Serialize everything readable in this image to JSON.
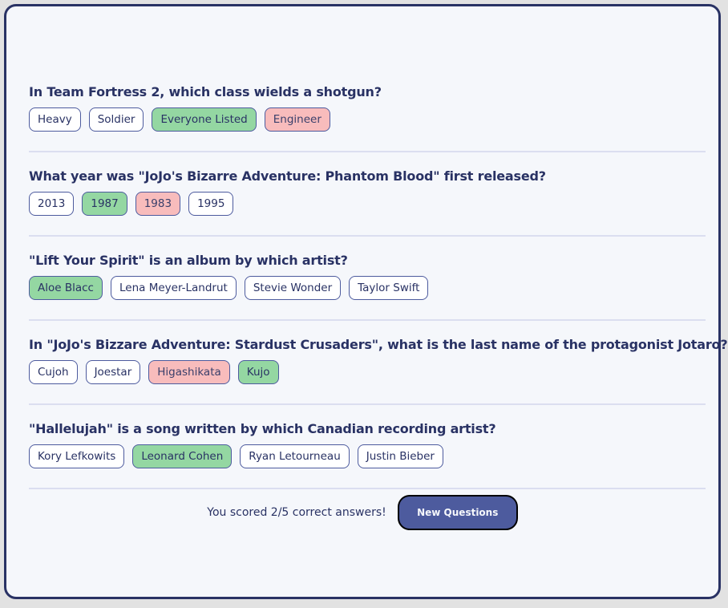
{
  "quiz": {
    "questions": [
      {
        "text": "In Team Fortress 2, which class wields a shotgun?",
        "answers": [
          {
            "label": "Heavy",
            "state": "neutral"
          },
          {
            "label": "Soldier",
            "state": "neutral"
          },
          {
            "label": "Everyone Listed",
            "state": "correct"
          },
          {
            "label": "Engineer",
            "state": "wrong"
          }
        ]
      },
      {
        "text": "What year was \"JoJo's Bizarre Adventure: Phantom Blood\" first released?",
        "answers": [
          {
            "label": "2013",
            "state": "neutral"
          },
          {
            "label": "1987",
            "state": "correct"
          },
          {
            "label": "1983",
            "state": "wrong"
          },
          {
            "label": "1995",
            "state": "neutral"
          }
        ]
      },
      {
        "text": "\"Lift Your Spirit\" is an album by which artist?",
        "answers": [
          {
            "label": "Aloe Blacc",
            "state": "correct"
          },
          {
            "label": "Lena Meyer-Landrut",
            "state": "neutral"
          },
          {
            "label": "Stevie Wonder",
            "state": "neutral"
          },
          {
            "label": "Taylor Swift",
            "state": "neutral"
          }
        ]
      },
      {
        "text": "In \"JoJo's Bizzare Adventure: Stardust Crusaders\", what is the last name of the protagonist Jotaro?",
        "answers": [
          {
            "label": "Cujoh",
            "state": "neutral"
          },
          {
            "label": "Joestar",
            "state": "neutral"
          },
          {
            "label": "Higashikata",
            "state": "wrong"
          },
          {
            "label": "Kujo",
            "state": "correct"
          }
        ]
      },
      {
        "text": "\"Hallelujah\" is a song written by which Canadian recording artist?",
        "answers": [
          {
            "label": "Kory Lefkowits",
            "state": "neutral"
          },
          {
            "label": "Leonard Cohen",
            "state": "correct"
          },
          {
            "label": "Ryan Letourneau",
            "state": "neutral"
          },
          {
            "label": "Justin Bieber",
            "state": "neutral"
          }
        ]
      }
    ]
  },
  "footer": {
    "score_text": "You scored 2/5 correct answers!",
    "new_questions_label": "New Questions"
  },
  "colors": {
    "primary": "#293264",
    "button": "#4d5b9e",
    "correct": "#94d7a2",
    "wrong": "#f8bcbc",
    "background": "#f5f7fb"
  }
}
